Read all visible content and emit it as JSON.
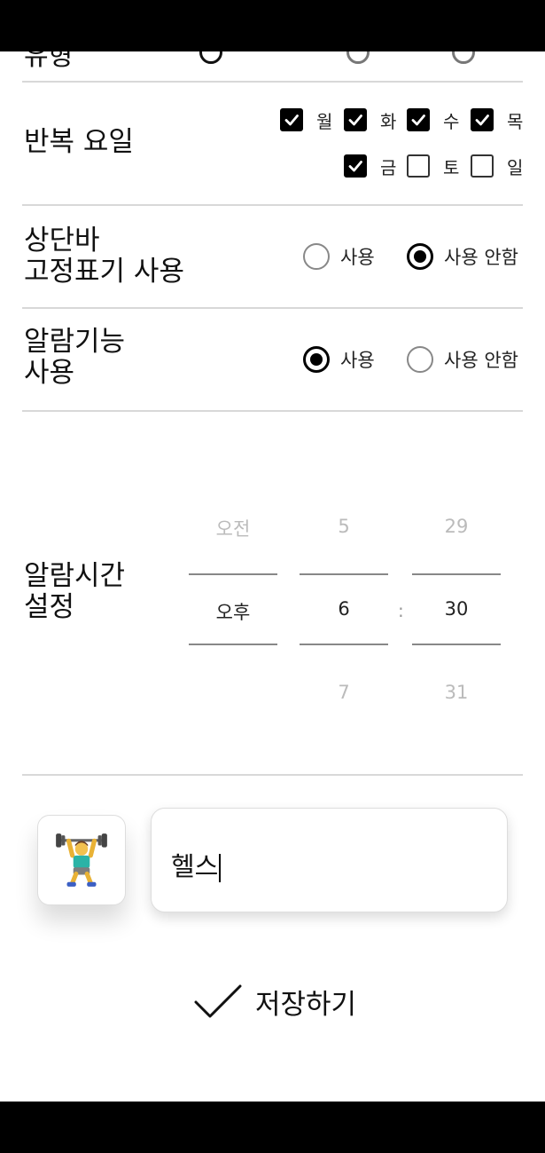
{
  "partial_row": {
    "label": "유형"
  },
  "repeat_days": {
    "label": "반복 요일",
    "days": [
      {
        "label": "월",
        "checked": true
      },
      {
        "label": "화",
        "checked": true
      },
      {
        "label": "수",
        "checked": true
      },
      {
        "label": "목",
        "checked": true
      },
      {
        "label": "금",
        "checked": true
      },
      {
        "label": "토",
        "checked": false
      },
      {
        "label": "일",
        "checked": false
      }
    ]
  },
  "top_bar_pin": {
    "label_line1": "상단바",
    "label_line2": "고정표기 사용",
    "options": [
      {
        "label": "사용",
        "selected": false
      },
      {
        "label": "사용 안함",
        "selected": true
      }
    ]
  },
  "alarm_feature": {
    "label_line1": "알람기능",
    "label_line2": "사용",
    "options": [
      {
        "label": "사용",
        "selected": true
      },
      {
        "label": "사용 안함",
        "selected": false
      }
    ]
  },
  "alarm_time": {
    "label_line1": "알람시간",
    "label_line2": "설정",
    "ampm": {
      "prev": "오전",
      "selected": "오후"
    },
    "hour": {
      "prev": "5",
      "selected": "6",
      "next": "7"
    },
    "minute": {
      "prev": "29",
      "selected": "30",
      "next": "31"
    },
    "separator": ":"
  },
  "routine": {
    "icon": "weightlifter-emoji-icon",
    "name_value": "헬스"
  },
  "save": {
    "label": "저장하기",
    "icon": "check-icon"
  }
}
